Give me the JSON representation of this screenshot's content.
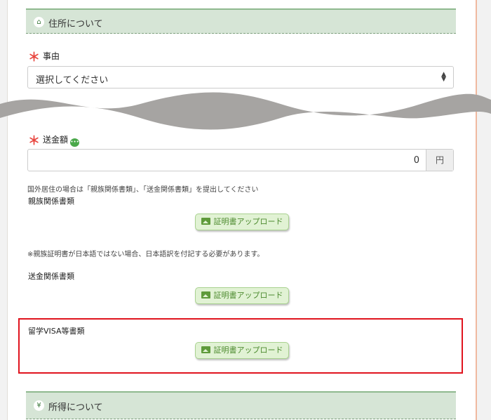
{
  "address_section": {
    "icon": "home-icon",
    "title": "住所について"
  },
  "reason": {
    "required_mark": "＊",
    "label": "事由",
    "selected": "選択してください"
  },
  "remittance": {
    "required_mark": "＊",
    "label": "送金額",
    "value": "0",
    "unit": "円"
  },
  "notes": {
    "overseas": "国外居住の場合は「親族関係書類」、「送金関係書類」を提出してください",
    "translation": "※親族証明書が日本語ではない場合、日本語訳を付記する必要があります。"
  },
  "documents": [
    {
      "label": "親族関係書類",
      "button": "証明書アップロード"
    },
    {
      "label": "送金関係書類",
      "button": "証明書アップロード"
    },
    {
      "label": "留学VISA等書類",
      "button": "証明書アップロード"
    }
  ],
  "income_section": {
    "icon": "yen-icon",
    "title": "所得について"
  },
  "colors": {
    "header_bg": "#d6e5d6",
    "button_bg": "#e1f2d4",
    "highlight": "#e0141e",
    "required": "#e8463f"
  }
}
